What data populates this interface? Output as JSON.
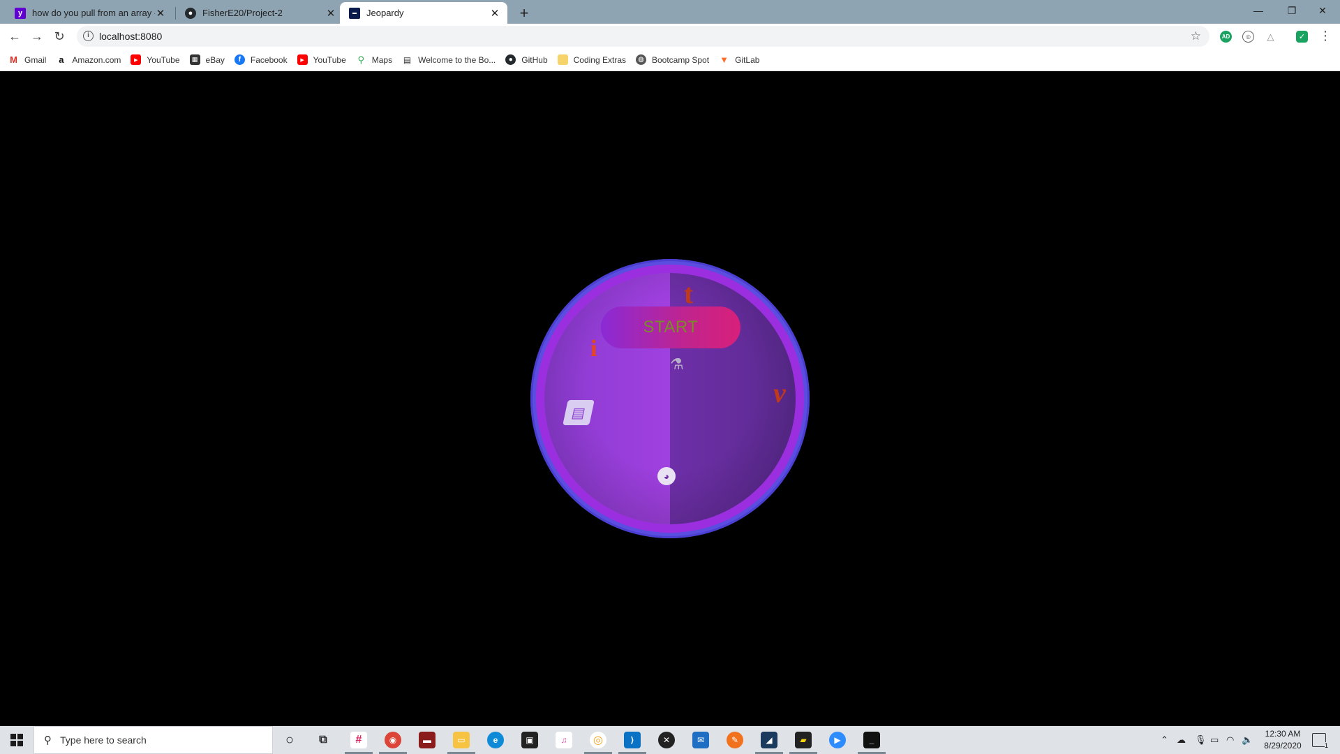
{
  "browser": {
    "tabs": [
      {
        "title": "how do you pull from an array - ",
        "favicon": "yahoo-icon",
        "favicon_color": "#6001d2",
        "active": false
      },
      {
        "title": "FisherE20/Project-2",
        "favicon": "github-icon",
        "favicon_color": "#24292e",
        "active": false
      },
      {
        "title": "Jeopardy",
        "favicon": "jeopardy-icon",
        "favicon_color": "#0a1a4a",
        "active": true
      }
    ],
    "url": "localhost:8080",
    "bookmarks": [
      {
        "label": "Gmail",
        "icon": "gmail-icon",
        "color": "#d93025"
      },
      {
        "label": "Amazon.com",
        "icon": "amazon-icon",
        "color": "#111111"
      },
      {
        "label": "YouTube",
        "icon": "youtube-icon",
        "color": "#ff0000"
      },
      {
        "label": "eBay",
        "icon": "ebay-icon",
        "color": "#e53238"
      },
      {
        "label": "Facebook",
        "icon": "facebook-icon",
        "color": "#1877f2"
      },
      {
        "label": "YouTube",
        "icon": "youtube-icon",
        "color": "#ff0000"
      },
      {
        "label": "Maps",
        "icon": "maps-icon",
        "color": "#34a853"
      },
      {
        "label": "Welcome to the Bo...",
        "icon": "book-icon",
        "color": "#333333"
      },
      {
        "label": "GitHub",
        "icon": "github-icon",
        "color": "#24292e"
      },
      {
        "label": "Coding Extras",
        "icon": "folder-icon",
        "color": "#f6d36b"
      },
      {
        "label": "Bootcamp Spot",
        "icon": "globe-icon",
        "color": "#555555"
      },
      {
        "label": "GitLab",
        "icon": "gitlab-icon",
        "color": "#fc6d26"
      }
    ]
  },
  "game": {
    "start_label": "START",
    "category_icons": [
      {
        "name": "tumblr-icon",
        "glyph": "t",
        "color": "#c03a1a"
      },
      {
        "name": "info-icon",
        "glyph": "i",
        "color": "#e8461a"
      },
      {
        "name": "vimeo-icon",
        "glyph": "v",
        "color": "#c03a1a"
      },
      {
        "name": "book-icon",
        "glyph": "▤",
        "color": "#d9cdf2"
      },
      {
        "name": "flask-icon",
        "glyph": "⚗",
        "color": "#b8b0c8"
      },
      {
        "name": "globe-icon",
        "glyph": "●",
        "color": "#e8e2f2"
      }
    ],
    "colors": {
      "ring": "#5a4de0",
      "face_left": "#a040e0",
      "face_right": "#5b2a90",
      "button_text": "#7a8c2a"
    }
  },
  "taskbar": {
    "search_placeholder": "Type here to search",
    "time": "12:30 AM",
    "date": "8/29/2020",
    "notification_count": "1"
  }
}
